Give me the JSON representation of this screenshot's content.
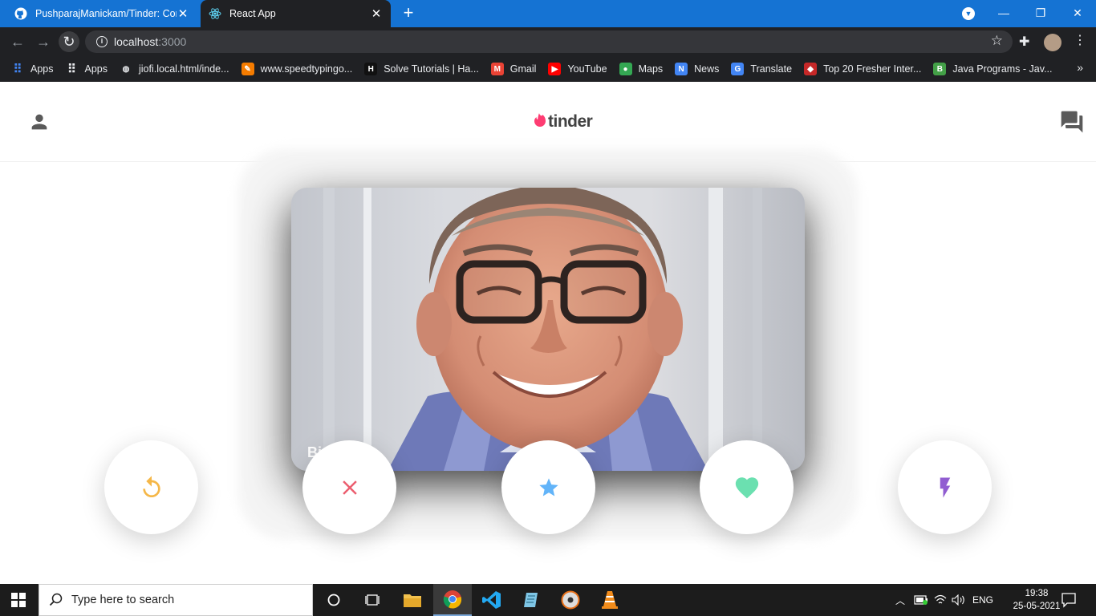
{
  "browser": {
    "tabs": [
      {
        "title": "PushparajManickam/Tinder: Cont",
        "favicon": "github-icon",
        "active": false
      },
      {
        "title": "React App",
        "favicon": "react-icon",
        "active": true
      }
    ],
    "new_tab_label": "+",
    "url_host": "localhost",
    "url_port": ":3000",
    "bookmarks": [
      {
        "label": "Apps",
        "icon": "apps-grid-icon",
        "color": "#4285f4"
      },
      {
        "label": "Apps",
        "icon": "apps-grid-icon",
        "color": "#e8eaed"
      },
      {
        "label": "jiofi.local.html/inde...",
        "icon": "globe-icon",
        "color": "#e8eaed"
      },
      {
        "label": "www.speedtypingo...",
        "icon": "speedtyping-icon",
        "color": "#f57c00"
      },
      {
        "label": "Solve Tutorials | Ha...",
        "icon": "hackerrank-icon",
        "color": "#111111"
      },
      {
        "label": "Gmail",
        "icon": "gmail-icon",
        "color": "#ea4335"
      },
      {
        "label": "YouTube",
        "icon": "youtube-icon",
        "color": "#ff0000"
      },
      {
        "label": "Maps",
        "icon": "maps-icon",
        "color": "#34a853"
      },
      {
        "label": "News",
        "icon": "news-icon",
        "color": "#4285f4"
      },
      {
        "label": "Translate",
        "icon": "translate-icon",
        "color": "#4285f4"
      },
      {
        "label": "Top 20 Fresher Inter...",
        "icon": "site-icon",
        "color": "#c62828"
      },
      {
        "label": "Java Programs - Jav...",
        "icon": "java-b-icon",
        "color": "#43a047"
      }
    ]
  },
  "app": {
    "logo_text": "tinder",
    "brand_color": "#fe3c72",
    "card": {
      "name": "Bill Gates",
      "visible_name": "Bi"
    },
    "buttons": [
      {
        "name": "replay-button",
        "icon": "replay-icon",
        "color": "#f5b748"
      },
      {
        "name": "nope-button",
        "icon": "close-icon",
        "color": "#ec5e6f"
      },
      {
        "name": "super-like-button",
        "icon": "star-icon",
        "color": "#62b4f9"
      },
      {
        "name": "like-button",
        "icon": "heart-icon",
        "color": "#6be0b0"
      },
      {
        "name": "boost-button",
        "icon": "flash-icon",
        "color": "#915dd1"
      }
    ]
  },
  "taskbar": {
    "search_placeholder": "Type here to search",
    "language": "ENG",
    "time": "19:38",
    "date": "25-05-2021"
  }
}
